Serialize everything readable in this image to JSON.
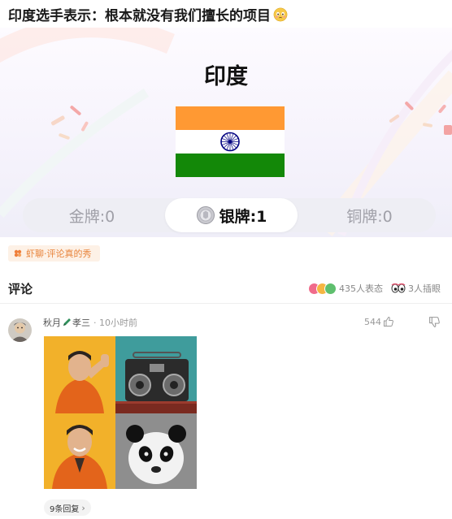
{
  "headline": "印度选手表示：根本就没有我们擅长的项目",
  "card": {
    "country": "印度",
    "gold": "金牌:0",
    "silver": "银牌:1",
    "bronze": "铜牌:0"
  },
  "source_tag": "虾聊·评论真的秀",
  "comments": {
    "title": "评论",
    "reactions": "435人表态",
    "peeking": "3人插眼"
  },
  "comment": {
    "author_first": "秋月",
    "author_second": "孝三",
    "time": "10小时前",
    "likes": "544",
    "replies": "9条回复",
    "reply_chevron": "›"
  },
  "colors": {
    "saffron": "#FF9933",
    "india_green": "#138808",
    "chakra_navy": "#000080",
    "tag_orange": "#e8833a"
  },
  "icons": [
    "blush-emoji-icon",
    "silver-medal-icon",
    "shrimp-icon",
    "reaction-icons",
    "peek-eyes-icon",
    "pen-icon",
    "thumbs-up-icon",
    "thumbs-down-icon"
  ]
}
